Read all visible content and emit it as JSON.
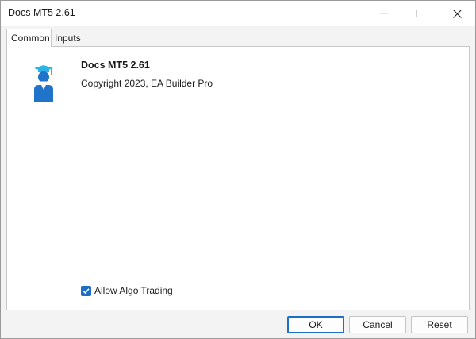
{
  "window": {
    "title": "Docs MT5 2.61"
  },
  "tabs": [
    {
      "label": "Common",
      "active": true
    },
    {
      "label": "Inputs",
      "active": false
    }
  ],
  "common": {
    "app_name": "Docs MT5 2.61",
    "copyright": "Copyright 2023, EA Builder Pro",
    "allow_algo_trading": {
      "label": "Allow Algo Trading",
      "checked": true
    }
  },
  "buttons": {
    "ok": "OK",
    "cancel": "Cancel",
    "reset": "Reset"
  },
  "colors": {
    "accent": "#1c6fc4",
    "logo_blue": "#1f74c9",
    "logo_cap": "#2bb3e6"
  },
  "icons": {
    "logo": "graduate-user-icon",
    "minimize": "minimize-icon",
    "maximize": "maximize-icon",
    "close": "close-icon",
    "check": "checkmark-icon"
  }
}
